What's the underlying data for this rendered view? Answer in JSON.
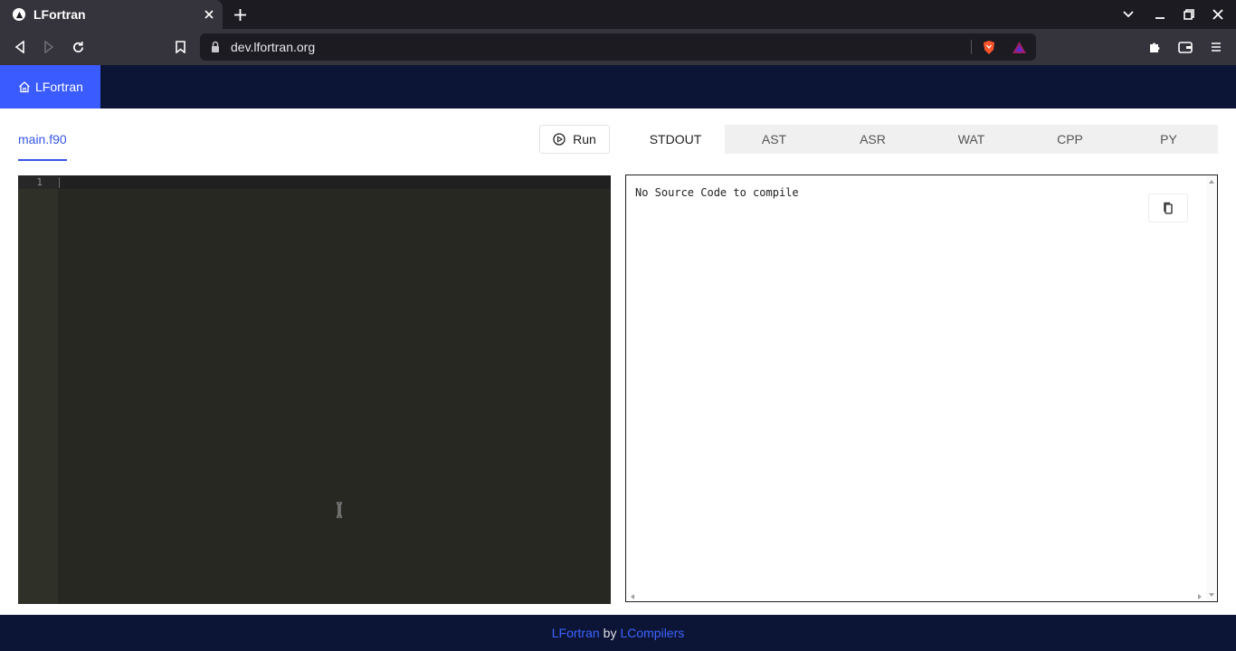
{
  "browser": {
    "tab_title": "LFortran",
    "url": "dev.lfortran.org",
    "colors": {
      "tabstrip": "#1c1b22",
      "toolbar": "#35343c"
    }
  },
  "app": {
    "nav": {
      "home_label": "LFortran"
    },
    "editor": {
      "file_tab": "main.f90",
      "line_numbers": [
        "1"
      ]
    },
    "run_label": "Run",
    "output_tabs": [
      "STDOUT",
      "AST",
      "ASR",
      "WAT",
      "CPP",
      "PY"
    ],
    "active_output_tab": "STDOUT",
    "output_text": "No Source Code to compile",
    "footer": {
      "left_link": "LFortran",
      "by": "by",
      "right_link": "LCompilers"
    },
    "colors": {
      "accent": "#3a5bff",
      "nav_bg": "#0d1536",
      "editor_bg": "#272822"
    }
  }
}
